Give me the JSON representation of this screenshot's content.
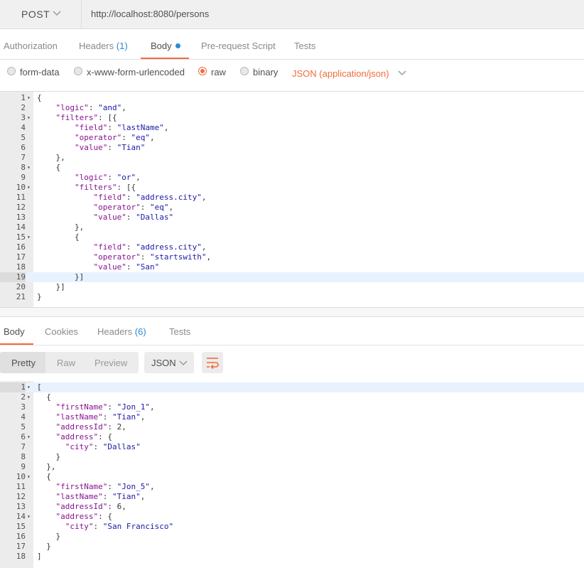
{
  "request": {
    "method": "POST",
    "url": "http://localhost:8080/persons",
    "tabs": [
      {
        "label": "Authorization",
        "count": ""
      },
      {
        "label": "Headers",
        "count": "(1)"
      },
      {
        "label": "Body",
        "count": ""
      },
      {
        "label": "Pre-request Script",
        "count": ""
      },
      {
        "label": "Tests",
        "count": ""
      }
    ],
    "active_tab": "Body",
    "body_types": [
      "form-data",
      "x-www-form-urlencoded",
      "raw",
      "binary"
    ],
    "selected_body_type": "raw",
    "content_type": "JSON (application/json)",
    "body_lines": [
      "{",
      "    \"logic\": \"and\",",
      "    \"filters\": [{",
      "        \"field\": \"lastName\",",
      "        \"operator\": \"eq\",",
      "        \"value\": \"Tian\"",
      "    },",
      "    {",
      "        \"logic\": \"or\",",
      "        \"filters\": [{",
      "            \"field\": \"address.city\",",
      "            \"operator\": \"eq\",",
      "            \"value\": \"Dallas\"",
      "        },",
      "        {",
      "            \"field\": \"address.city\",",
      "            \"operator\": \"startswith\",",
      "            \"value\": \"San\"",
      "        }]",
      "    }]",
      "}"
    ],
    "fold_lines": [
      1,
      3,
      8,
      10,
      15
    ],
    "highlight_line": 19
  },
  "response": {
    "tabs": [
      {
        "label": "Body",
        "count": ""
      },
      {
        "label": "Cookies",
        "count": ""
      },
      {
        "label": "Headers",
        "count": "(6)"
      },
      {
        "label": "Tests",
        "count": ""
      }
    ],
    "active_tab": "Body",
    "view_modes": [
      "Pretty",
      "Raw",
      "Preview"
    ],
    "active_view": "Pretty",
    "format": "JSON",
    "wrap_icon": "wrap-lines-icon",
    "body_lines": [
      "[",
      "  {",
      "    \"firstName\": \"Jon_1\",",
      "    \"lastName\": \"Tian\",",
      "    \"addressId\": 2,",
      "    \"address\": {",
      "      \"city\": \"Dallas\"",
      "    }",
      "  },",
      "  {",
      "    \"firstName\": \"Jon_5\",",
      "    \"lastName\": \"Tian\",",
      "    \"addressId\": 6,",
      "    \"address\": {",
      "      \"city\": \"San Francisco\"",
      "    }",
      "  }",
      "]"
    ],
    "fold_lines": [
      1,
      2,
      6,
      10,
      14
    ],
    "highlight_line": 1
  },
  "colors": {
    "accent": "#f26b3a",
    "link": "#2a8bd2"
  }
}
